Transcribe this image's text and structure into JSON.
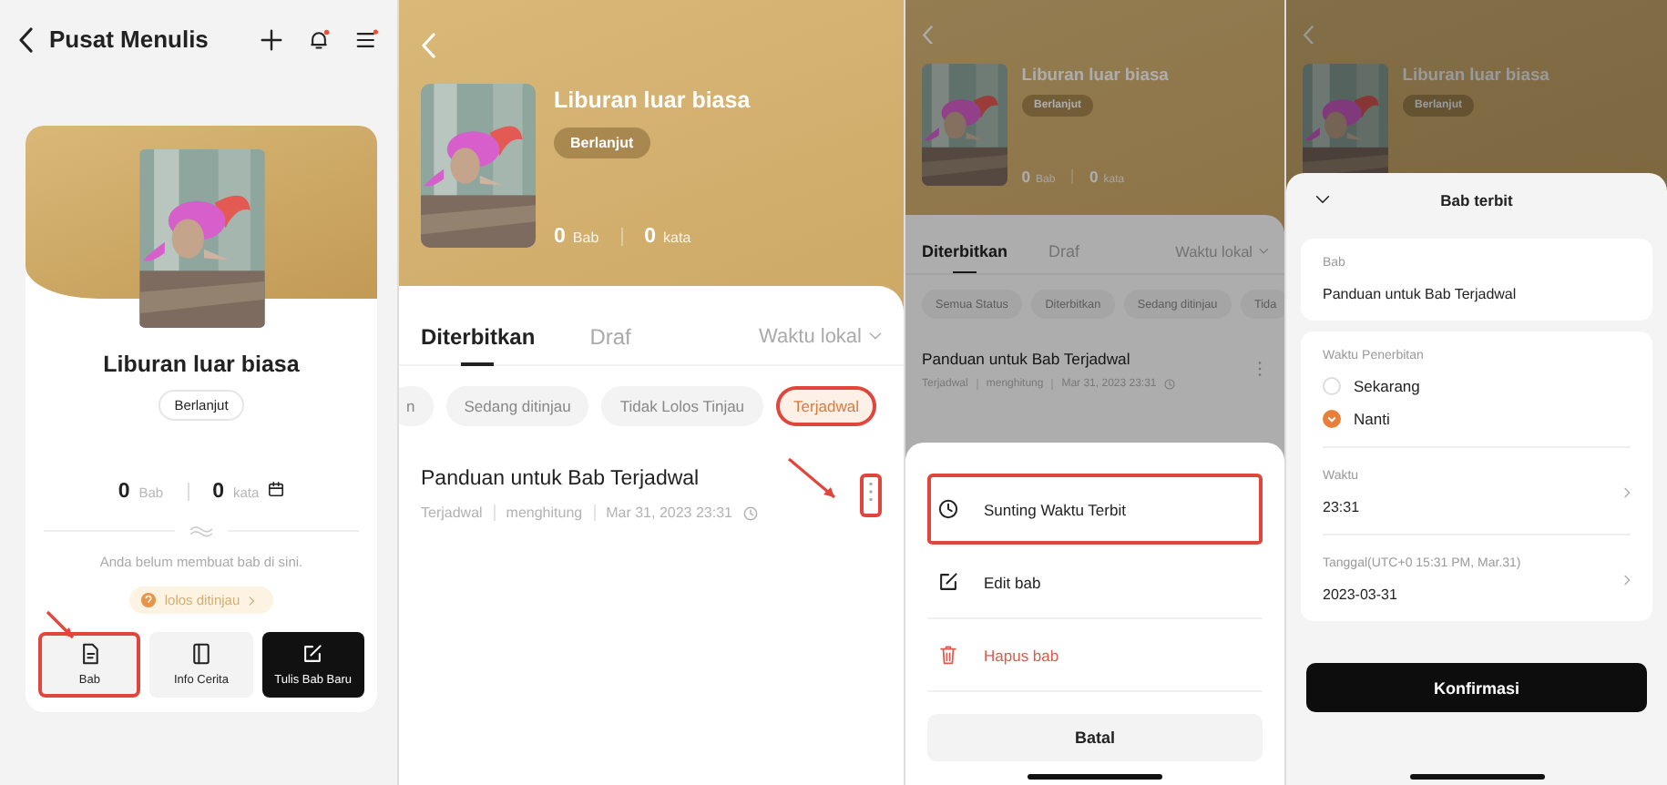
{
  "writing_center": {
    "title": "Pusat Menulis",
    "book": {
      "title": "Liburan luar biasa",
      "status": "Berlanjut",
      "chapters": "0",
      "chapters_unit": "Bab",
      "words": "0",
      "words_unit": "kata"
    },
    "empty_text": "Anda belum membuat bab di sini.",
    "review_link": "lolos ditinjau",
    "buttons": [
      {
        "kind": "chapters",
        "label": "Bab",
        "highlighted": true
      },
      {
        "kind": "info",
        "label": "Info Cerita",
        "highlighted": false
      },
      {
        "kind": "write",
        "label": "Tulis Bab Baru",
        "highlighted": false
      }
    ]
  },
  "chapter_list": {
    "book": {
      "title": "Liburan luar biasa",
      "status": "Berlanjut",
      "chapters": "0",
      "chapters_unit": "Bab",
      "words": "0",
      "words_unit": "kata"
    },
    "tabs": [
      {
        "label": "Diterbitkan",
        "selected": true
      },
      {
        "label": "Draf",
        "selected": false
      }
    ],
    "sort": "Waktu lokal",
    "filters": [
      {
        "label": "n",
        "selected": false,
        "highlighted": false
      },
      {
        "label": "Sedang ditinjau",
        "selected": false,
        "highlighted": false
      },
      {
        "label": "Tidak Lolos Tinjau",
        "selected": false,
        "highlighted": false
      },
      {
        "label": "Terjadwal",
        "selected": true,
        "highlighted": true
      }
    ],
    "chapters": [
      {
        "title": "Panduan untuk Bab Terjadwal",
        "status": "Terjadwal",
        "words": "menghitung",
        "time": "Mar 31, 2023 23:31",
        "menu_highlighted": true
      }
    ]
  },
  "chapter_actions": {
    "book": {
      "title": "Liburan luar biasa",
      "status": "Berlanjut",
      "chapters": "0",
      "chapters_unit": "Bab",
      "words": "0",
      "words_unit": "kata"
    },
    "tabs": [
      {
        "label": "Diterbitkan",
        "selected": true
      },
      {
        "label": "Draf",
        "selected": false
      }
    ],
    "sort": "Waktu lokal",
    "filters": [
      {
        "label": "Semua Status",
        "selected": false,
        "highlighted": false
      },
      {
        "label": "Diterbitkan",
        "selected": false,
        "highlighted": false
      },
      {
        "label": "Sedang ditinjau",
        "selected": false,
        "highlighted": false
      },
      {
        "label": "Tida",
        "selected": false,
        "highlighted": false
      }
    ],
    "chapters": [
      {
        "title": "Panduan untuk Bab Terjadwal",
        "status": "Terjadwal",
        "words": "menghitung",
        "time": "Mar 31, 2023 23:31",
        "menu_highlighted": false
      }
    ],
    "actions": [
      {
        "kind": "schedule",
        "label": "Sunting Waktu Terbit",
        "highlighted": true
      },
      {
        "kind": "edit",
        "label": "Edit bab",
        "highlighted": false
      },
      {
        "kind": "delete",
        "label": "Hapus bab",
        "highlighted": false
      }
    ],
    "cancel": "Batal"
  },
  "publish_sheet": {
    "book": {
      "title": "Liburan luar biasa",
      "status": "Berlanjut"
    },
    "title": "Bab terbit",
    "chapter_label": "Bab",
    "chapter_value": "Panduan untuk Bab Terjadwal",
    "time_label": "Waktu Penerbitan",
    "options": [
      {
        "label": "Sekarang",
        "selected": false
      },
      {
        "label": "Nanti",
        "selected": true
      }
    ],
    "fields": [
      {
        "label": "Waktu",
        "value": "23:31"
      },
      {
        "label": "Tanggal(UTC+0 15:31 PM, Mar.31)",
        "value": "2023-03-31"
      }
    ],
    "confirm": "Konfirmasi"
  }
}
